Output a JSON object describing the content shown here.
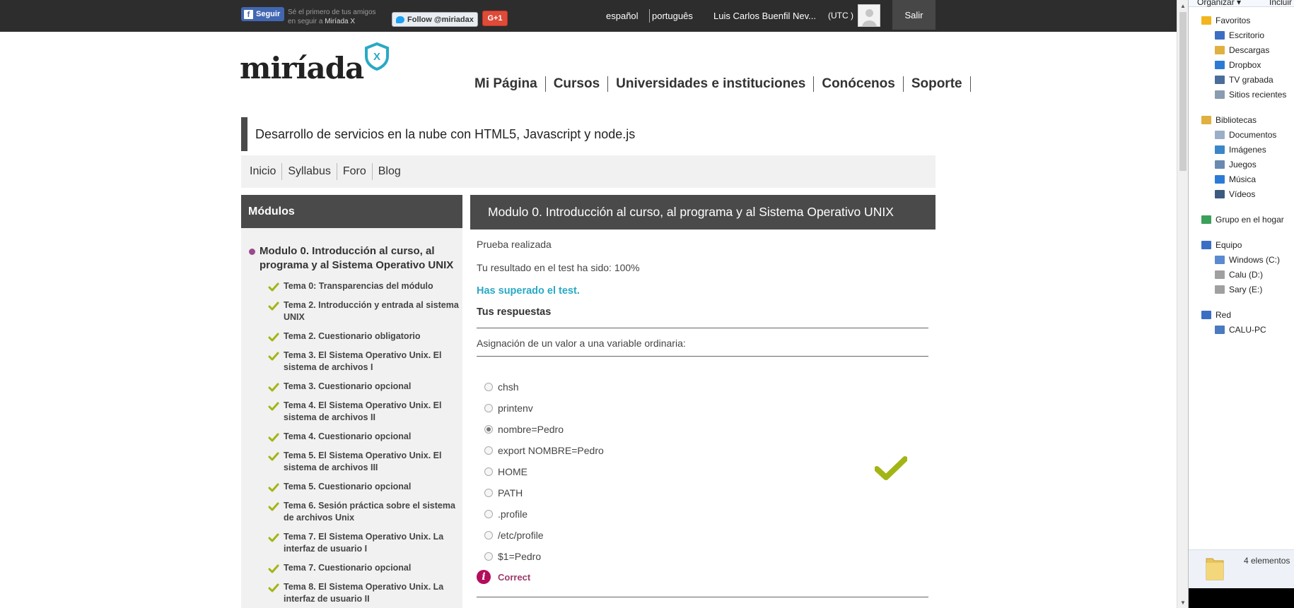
{
  "topbar": {
    "fb_button": "Seguir",
    "fb_text_line1": "Sé el primero de tus amigos",
    "fb_text_line2_prefix": "en seguir a ",
    "fb_text_brand": "Miríada X",
    "twitter_button": "Follow @miriadax",
    "gplus_button": "G+1",
    "lang_es": "español",
    "lang_pt": "português",
    "user_name": "Luis Carlos Buenfil Nev...",
    "timezone": "(UTC )",
    "logout": "Salir"
  },
  "logo": {
    "text": "miríada",
    "shield_letter": "X"
  },
  "main_nav": [
    "Mi Página",
    "Cursos",
    "Universidades e instituciones",
    "Conócenos",
    "Soporte"
  ],
  "course": {
    "title": "Desarrollo de servicios en la nube con HTML5, Javascript y node.js",
    "subnav": [
      "Inicio",
      "Syllabus",
      "Foro",
      "Blog"
    ]
  },
  "sidebar": {
    "heading": "Módulos",
    "module_title": "Modulo 0. Introducción al curso, al programa y al Sistema Operativo UNIX",
    "items": [
      "Tema 0: Transparencias del módulo",
      "Tema 2. Introducción y entrada al sistema UNIX",
      "Tema 2. Cuestionario obligatorio",
      "Tema 3. El Sistema Operativo Unix. El sistema de archivos I",
      "Tema 3. Cuestionario opcional",
      "Tema 4. El Sistema Operativo Unix. El sistema de archivos II",
      "Tema 4. Cuestionario opcional",
      "Tema 5. El Sistema Operativo Unix. El sistema de archivos III",
      "Tema 5. Cuestionario opcional",
      "Tema 6. Sesión práctica sobre el sistema de archivos Unix",
      "Tema 7. El Sistema Operativo Unix. La interfaz de usuario I",
      "Tema 7. Cuestionario opcional",
      "Tema 8. El Sistema Operativo Unix. La interfaz de usuario II"
    ]
  },
  "main": {
    "heading": "Modulo 0. Introducción al curso, al programa y al Sistema Operativo UNIX",
    "status": "Prueba realizada",
    "result": "Tu resultado en el test ha sido: 100%",
    "passed": "Has superado el test.",
    "answers_heading": "Tus respuestas",
    "question": "Asignación de un valor a una variable ordinaria:",
    "options": [
      "chsh",
      "printenv",
      "nombre=Pedro",
      "export NOMBRE=Pedro",
      "HOME",
      "PATH",
      ".profile",
      "/etc/profile",
      "$1=Pedro"
    ],
    "selected_option": "nombre=Pedro",
    "feedback": "Correct"
  },
  "explorer": {
    "toolbar_organize": "Organizar ▾",
    "toolbar_include": "Incluir",
    "favorites_label": "Favoritos",
    "favorites": [
      "Escritorio",
      "Descargas",
      "Dropbox",
      "TV grabada",
      "Sitios recientes"
    ],
    "libraries_label": "Bibliotecas",
    "libraries": [
      "Documentos",
      "Imágenes",
      "Juegos",
      "Música",
      "Vídeos"
    ],
    "homegroup": "Grupo en el hogar",
    "computer_label": "Equipo",
    "drives": [
      "Windows (C:)",
      "Calu (D:)",
      "Sary (E:)"
    ],
    "network_label": "Red",
    "network_items": [
      "CALU-PC"
    ],
    "status_count": "4 elementos"
  },
  "colors": {
    "accent_teal": "#29a9c5",
    "check_green": "#a3b515",
    "dark_header": "#4a4a4a",
    "info_magenta": "#b30d5c"
  }
}
